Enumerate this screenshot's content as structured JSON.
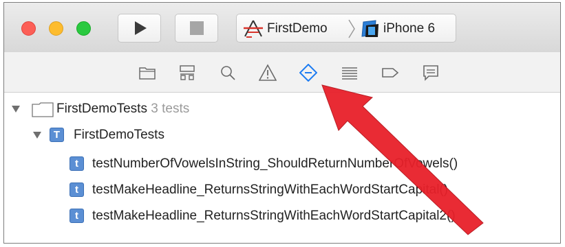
{
  "toolbar": {
    "run_icon": "play-icon",
    "stop_icon": "stop-icon",
    "scheme": {
      "app_name": "FirstDemo",
      "device_name": "iPhone 6"
    }
  },
  "navigator": {
    "icons": [
      "folder-icon",
      "symbol-icon",
      "search-icon",
      "warning-icon",
      "test-navigator-icon",
      "debug-navigator-icon",
      "breakpoint-icon",
      "report-icon"
    ],
    "active": "test-navigator-icon",
    "accent_color": "#1d7cf2"
  },
  "test_tree": {
    "bundle": {
      "name": "FirstDemoTests",
      "count": "3 tests"
    },
    "test_class": {
      "badge": "T",
      "name": "FirstDemoTests"
    },
    "tests": [
      {
        "badge": "t",
        "name": "testNumberOfVowelsInString_ShouldReturnNumberOfVowels()"
      },
      {
        "badge": "t",
        "name": "testMakeHeadline_ReturnsStringWithEachWordStartCapital()"
      },
      {
        "badge": "t",
        "name": "testMakeHeadline_ReturnsStringWithEachWordStartCapital2()"
      }
    ]
  },
  "annotation": {
    "arrow_color": "#e8202a"
  }
}
